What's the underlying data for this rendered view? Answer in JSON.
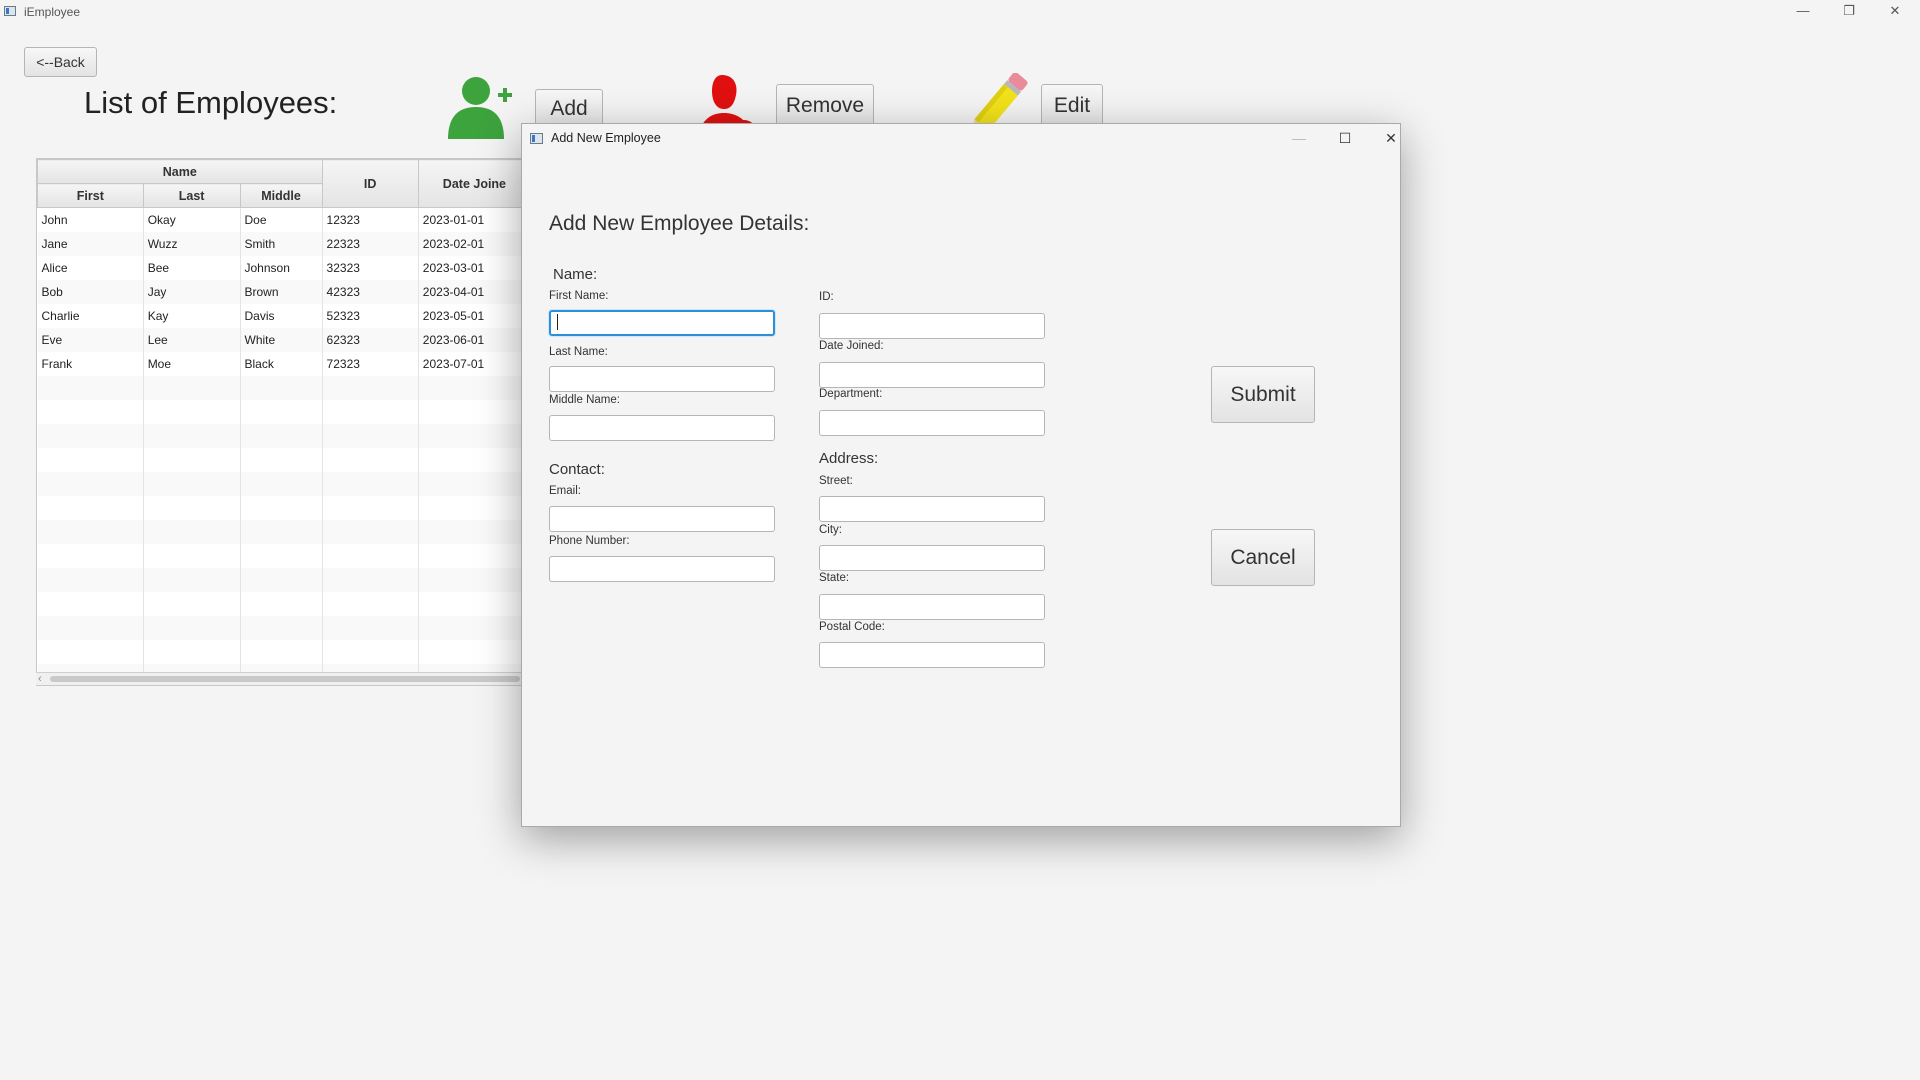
{
  "window": {
    "title": "iEmployee",
    "controls": {
      "minimize": "—",
      "restore": "❐",
      "close": "✕"
    }
  },
  "toolbar": {
    "back_label": "<--Back",
    "list_title": "List of Employees:",
    "add_label": "Add",
    "remove_label": "Remove",
    "edit_label": "Edit"
  },
  "table": {
    "group_header": "Name",
    "columns": {
      "first": "First",
      "last": "Last",
      "middle": "Middle",
      "id": "ID",
      "date": "Date Joine"
    },
    "rows": [
      {
        "first": "John",
        "last": "Okay",
        "middle": "Doe",
        "id": "12323",
        "date": "2023-01-01"
      },
      {
        "first": "Jane",
        "last": "Wuzz",
        "middle": "Smith",
        "id": "22323",
        "date": "2023-02-01"
      },
      {
        "first": "Alice",
        "last": "Bee",
        "middle": "Johnson",
        "id": "32323",
        "date": "2023-03-01"
      },
      {
        "first": "Bob",
        "last": "Jay",
        "middle": "Brown",
        "id": "42323",
        "date": "2023-04-01"
      },
      {
        "first": "Charlie",
        "last": "Kay",
        "middle": "Davis",
        "id": "52323",
        "date": "2023-05-01"
      },
      {
        "first": "Eve",
        "last": "Lee",
        "middle": "White",
        "id": "62323",
        "date": "2023-06-01"
      },
      {
        "first": "Frank",
        "last": "Moe",
        "middle": "Black",
        "id": "72323",
        "date": "2023-07-01"
      }
    ]
  },
  "dialog": {
    "title": "Add New Employee",
    "controls": {
      "minimize": "—",
      "maximize": "☐",
      "close": "✕"
    },
    "heading": "Add New Employee Details:",
    "name_section": "Name:",
    "first_name_label": "First Name:",
    "last_name_label": "Last Name:",
    "middle_name_label": "Middle Name:",
    "contact_section": "Contact:",
    "email_label": "Email:",
    "phone_label": "Phone Number:",
    "id_label": "ID:",
    "date_joined_label": "Date Joined:",
    "department_label": "Department:",
    "address_section": "Address:",
    "street_label": "Street:",
    "city_label": "City:",
    "state_label": "State:",
    "postal_label": "Postal Code:",
    "submit_label": "Submit",
    "cancel_label": "Cancel",
    "values": {
      "first_name": "",
      "last_name": "",
      "middle_name": "",
      "email": "",
      "phone": "",
      "id": "",
      "date_joined": "",
      "department": "",
      "street": "",
      "city": "",
      "state": "",
      "postal": ""
    }
  },
  "icons": {
    "add_user_color": "#3da33d",
    "remove_user_color": "#e01010",
    "pencil_color": "#f2e21a",
    "focus_color": "#2e8fd9"
  }
}
